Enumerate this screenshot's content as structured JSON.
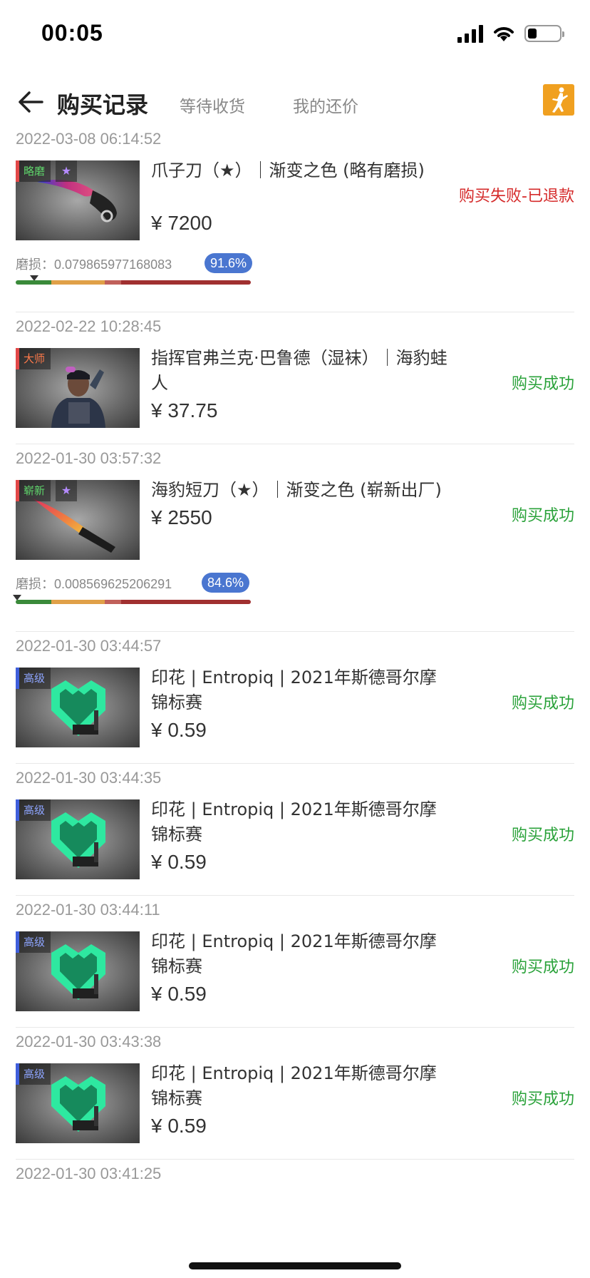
{
  "status_bar": {
    "time": "00:05"
  },
  "header": {
    "title": "购买记录",
    "tabs": [
      "等待收货",
      "我的还价"
    ]
  },
  "records": [
    {
      "time": "2022-03-08 06:14:52",
      "tag": "略磨",
      "star": "★",
      "name": "爪子刀（★）｜渐变之色 (略有磨损)",
      "price": "¥ 7200",
      "status": "购买失败-已退款",
      "wear_label": "磨损：0.079865977168083",
      "wear_percent": "91.6%",
      "wear_value": 0.079865977168083
    },
    {
      "time": "2022-02-22 10:28:45",
      "tag": "大师",
      "name": "指挥官弗兰克·巴鲁德（湿袜）｜海豹蛙人",
      "price": "¥ 37.75",
      "status": "购买成功"
    },
    {
      "time": "2022-01-30 03:57:32",
      "tag": "崭新",
      "star": "★",
      "name": "海豹短刀（★）｜渐变之色 (崭新出厂)",
      "price": "¥ 2550",
      "status": "购买成功",
      "wear_label": "磨损：0.008569625206291",
      "wear_percent": "84.6%",
      "wear_value": 0.008569625206291
    },
    {
      "time": "2022-01-30 03:44:57",
      "tag": "高级",
      "name": "印花 | Entropiq | 2021年斯德哥尔摩锦标赛",
      "price": "¥ 0.59",
      "status": "购买成功"
    },
    {
      "time": "2022-01-30 03:44:35",
      "tag": "高级",
      "name": "印花 | Entropiq | 2021年斯德哥尔摩锦标赛",
      "price": "¥ 0.59",
      "status": "购买成功"
    },
    {
      "time": "2022-01-30 03:44:11",
      "tag": "高级",
      "name": "印花 | Entropiq | 2021年斯德哥尔摩锦标赛",
      "price": "¥ 0.59",
      "status": "购买成功"
    },
    {
      "time": "2022-01-30 03:43:38",
      "tag": "高级",
      "name": "印花 | Entropiq | 2021年斯德哥尔摩锦标赛",
      "price": "¥ 0.59",
      "status": "购买成功"
    },
    {
      "time": "2022-01-30 03:41:25"
    }
  ],
  "colors": {
    "fail": "#d52a2a",
    "success": "#2aa23a",
    "badge": "#4a76d0",
    "wear_green": "#3a8a3a",
    "wear_orange": "#e0a048",
    "wear_pink": "#c0605a",
    "wear_red": "#a03030"
  },
  "icons": {
    "back": "back-arrow-icon",
    "game": "counter-strike-logo-icon"
  }
}
